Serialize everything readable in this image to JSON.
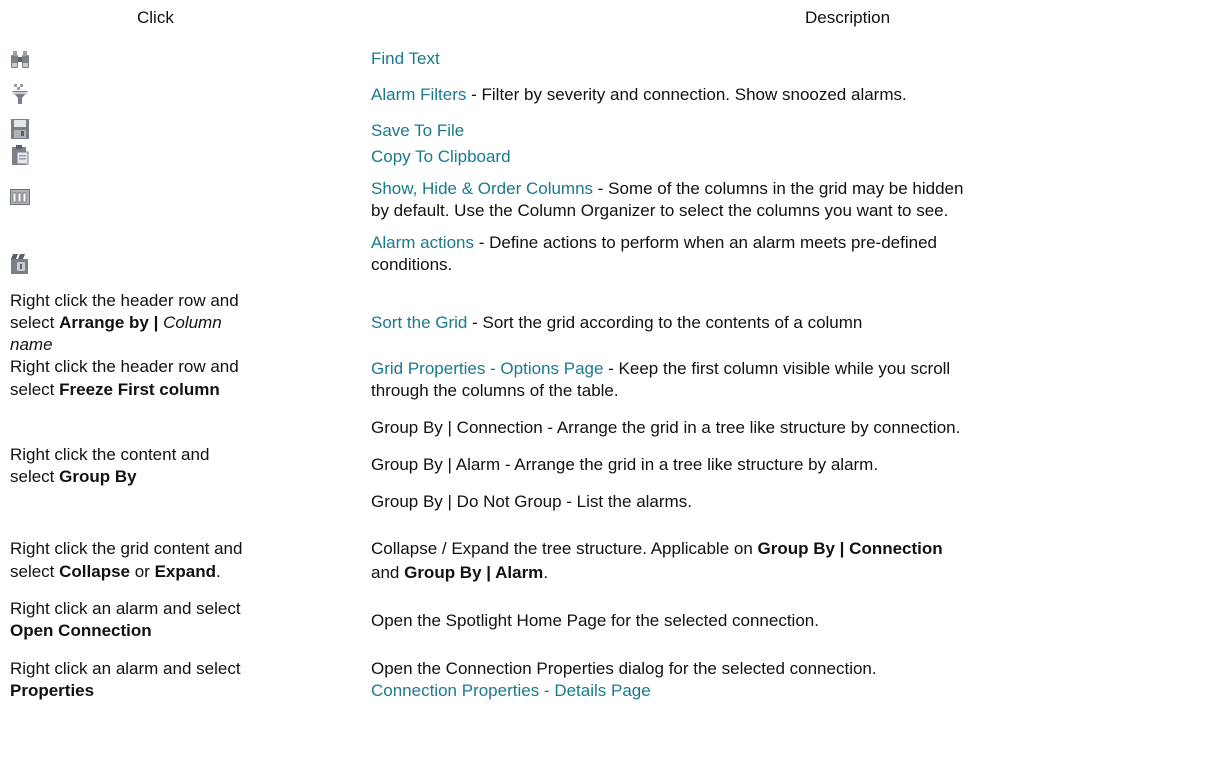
{
  "headers": {
    "click": "Click",
    "description": "Description"
  },
  "colors": {
    "link": "#1a7a8c",
    "icon_gray": "#6d7278"
  },
  "rows": {
    "find_text": {
      "icon": "binoculars-icon",
      "link": "Find Text"
    },
    "alarm_filters": {
      "icon": "filter-icon",
      "link": "Alarm Filters",
      "desc": " - Filter by severity and connection. Show snoozed alarms."
    },
    "save_to_file": {
      "icon": "save-icon",
      "link": "Save To File"
    },
    "copy_clipboard": {
      "icon": "clipboard-icon",
      "link": "Copy To Clipboard"
    },
    "columns": {
      "icon": "columns-icon",
      "link": "Show, Hide & Order Columns",
      "desc1": " - Some of the columns in the grid may be hidden",
      "desc2": "by default. Use the Column Organizer to select the columns you want to see."
    },
    "alarm_actions": {
      "icon": "alarm-actions-icon",
      "link": "Alarm actions",
      "desc1": " - Define actions to perform when an alarm meets pre-defined",
      "desc2": "conditions."
    },
    "sort": {
      "click1": "Right click the header row and",
      "click2_pre": "select ",
      "click2_bold": "Arrange by | ",
      "click2_italic": "Column",
      "click3_italic": "name",
      "link": "Sort the Grid",
      "desc": " - Sort the grid according to the contents of a column"
    },
    "freeze": {
      "click1": "Right click the header row and",
      "click2_pre": "select ",
      "click2_bold": "Freeze First column",
      "link": "Grid Properties - Options Page",
      "desc1": " - Keep the first column visible while you scroll",
      "desc2": "through the columns of the table."
    },
    "group": {
      "click1": "Right click the content and",
      "click2_pre": "select ",
      "click2_bold": "Group By",
      "item1": "Group By | Connection - Arrange the grid in a tree like structure by connection.",
      "item2": "Group By | Alarm - Arrange the grid in a tree like structure by alarm.",
      "item3": "Group By | Do Not Group - List the alarms."
    },
    "collapse": {
      "click1": "Right click the grid content and",
      "click2_pre": "select ",
      "click2_bold1": "Collapse",
      "click2_mid": " or ",
      "click2_bold2": "Expand",
      "click2_end": ".",
      "desc1_pre": "Collapse / Expand the tree structure. Applicable on ",
      "desc1_bold": "Group By | Connection",
      "desc2_pre": "and ",
      "desc2_bold": "Group By | Alarm",
      "desc2_end": "."
    },
    "open_conn": {
      "click1": "Right click an alarm and select",
      "click2_bold": "Open Connection",
      "desc": "Open the Spotlight Home Page for the selected connection."
    },
    "properties": {
      "click1": "Right click an alarm and select",
      "click2_bold": "Properties",
      "desc": "Open the Connection Properties dialog for the selected connection.",
      "link": "Connection Properties - Details Page"
    }
  }
}
